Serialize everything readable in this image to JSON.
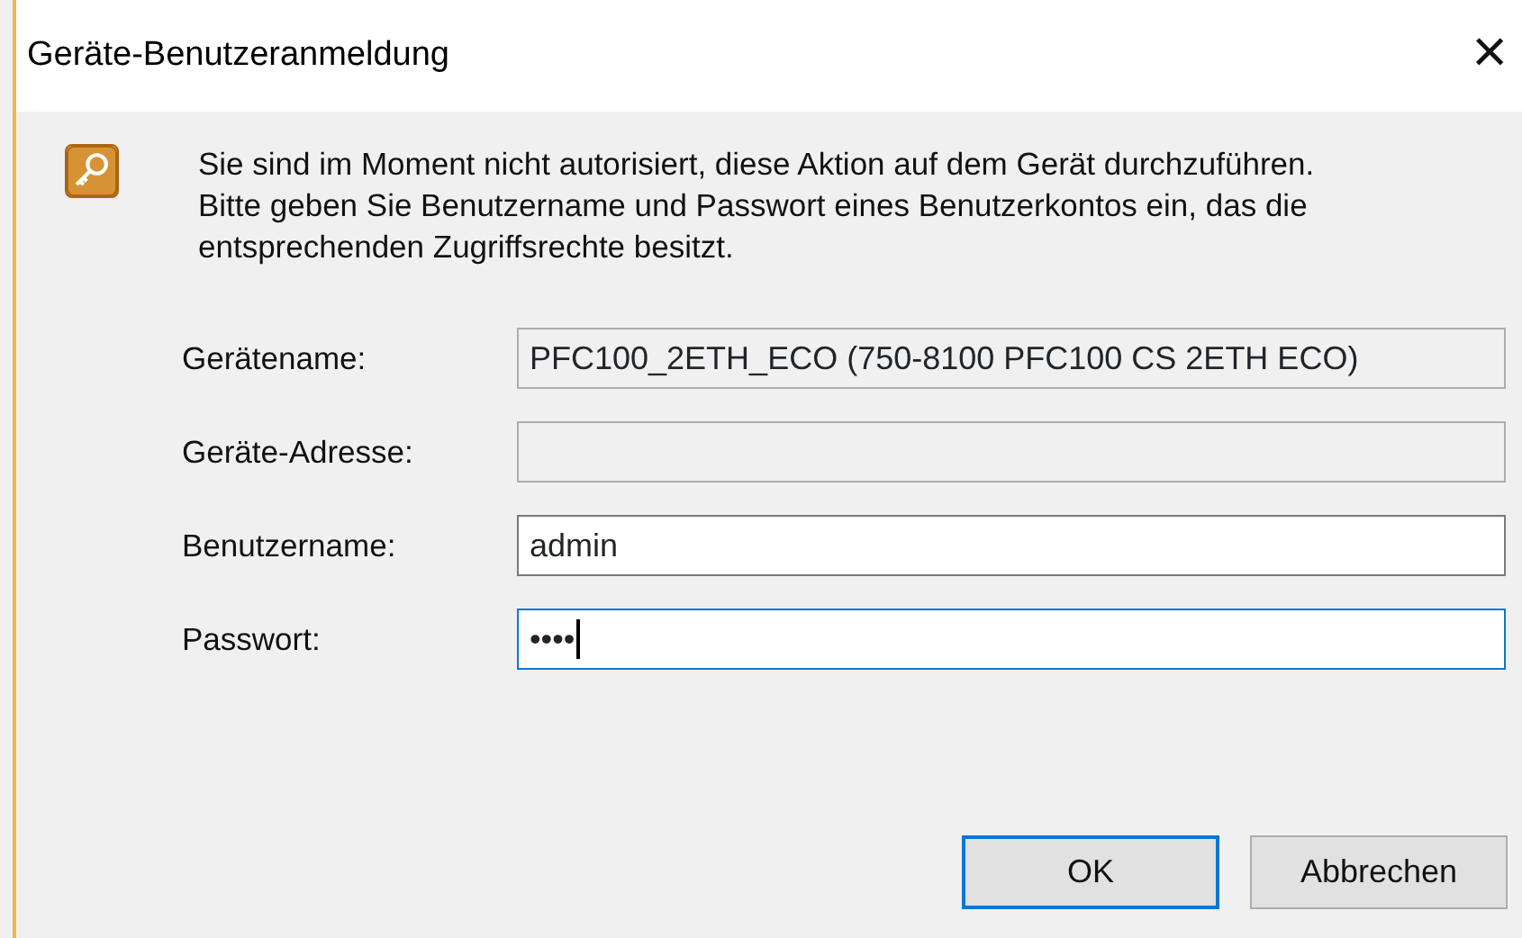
{
  "window": {
    "title": "Geräte-Benutzeranmeldung",
    "close": "×"
  },
  "message": "Sie sind im Moment nicht autorisiert, diese Aktion auf dem Gerät durchzuführen. Bitte geben Sie Benutzername und Passwort eines Benutzerkontos ein, das die entsprechenden Zugriffsrechte besitzt.",
  "fields": [
    {
      "label": "Gerätename:",
      "value": "PFC100_2ETH_ECO (750-8100 PFC100 CS 2ETH ECO)",
      "readonly": true,
      "focused": false
    },
    {
      "label": "Geräte-Adresse:",
      "readonly": true,
      "focused": false
    },
    {
      "label": "Benutzername:",
      "value": "admin",
      "readonly": false,
      "focused": false
    },
    {
      "label": "Passwort:",
      "value": "••••",
      "readonly": false,
      "focused": true
    }
  ],
  "buttons": [
    {
      "label": "OK",
      "default": true
    },
    {
      "label": "Abbrechen",
      "default": false
    }
  ]
}
